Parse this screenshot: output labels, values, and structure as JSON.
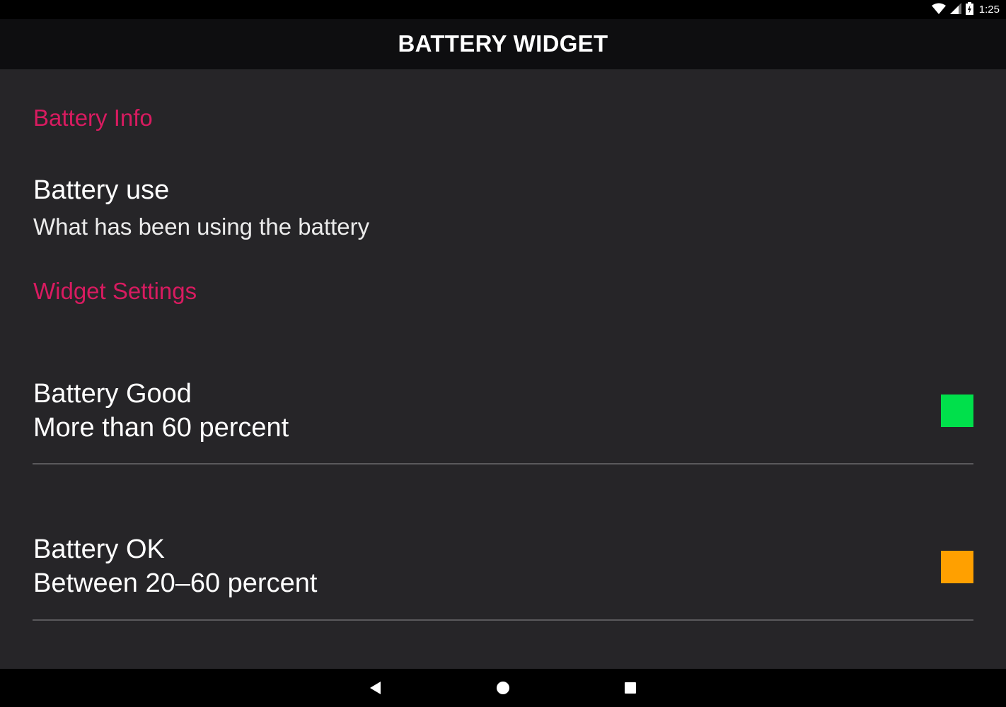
{
  "status_bar": {
    "time": "1:25",
    "icons": [
      "wifi-icon",
      "cell-signal-icon",
      "battery-icon"
    ]
  },
  "app_bar": {
    "title": "BATTERY WIDGET"
  },
  "sections": {
    "battery_info": {
      "header": "Battery Info",
      "battery_use": {
        "title": "Battery use",
        "summary": "What has been using the battery"
      }
    },
    "widget_settings": {
      "header": "Widget Settings",
      "battery_good": {
        "title": "Battery Good",
        "summary": "More than 60 percent",
        "color": "#00e04b"
      },
      "battery_ok": {
        "title": "Battery OK",
        "summary": "Between 20–60 percent",
        "color": "#ffa000"
      }
    }
  },
  "colors": {
    "background": "#262528",
    "app_bar": "#0e0e10",
    "accent": "#d81b60"
  },
  "nav_bar": {
    "icons": [
      "back-icon",
      "home-icon",
      "recents-icon"
    ]
  }
}
